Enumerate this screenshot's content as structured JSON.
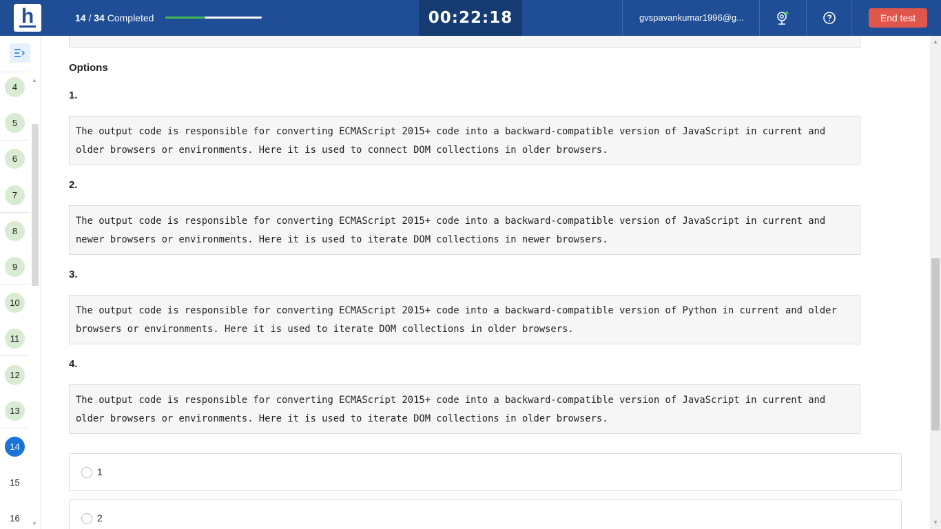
{
  "header": {
    "logo_letter": "h",
    "progress_current": "14",
    "progress_total": "34",
    "progress_suffix": "Completed",
    "progress_fraction": 0.4118,
    "timer": "00:22:18",
    "user": "gvspavankumar1996@g...",
    "end_label": "End test"
  },
  "sidebar": {
    "questions": [
      {
        "n": "4",
        "state": "answered"
      },
      {
        "n": "5",
        "state": "answered"
      },
      {
        "n": "6",
        "state": "answered"
      },
      {
        "n": "7",
        "state": "answered"
      },
      {
        "n": "8",
        "state": "answered"
      },
      {
        "n": "9",
        "state": "answered"
      },
      {
        "n": "10",
        "state": "answered"
      },
      {
        "n": "11",
        "state": "answered"
      },
      {
        "n": "12",
        "state": "answered"
      },
      {
        "n": "13",
        "state": "answered"
      },
      {
        "n": "14",
        "state": "current"
      },
      {
        "n": "15",
        "state": "unanswered"
      },
      {
        "n": "16",
        "state": "unanswered"
      }
    ]
  },
  "question": {
    "options_title": "Options",
    "options": [
      {
        "num": "1.",
        "text": "The output code is responsible for converting ECMAScript 2015+ code into a backward-compatible version of JavaScript in current and older browsers or environments. Here it is used to connect DOM collections in older browsers."
      },
      {
        "num": "2.",
        "text": "The output code is responsible for converting ECMAScript 2015+ code into a backward-compatible version of JavaScript in current and newer browsers or environments. Here it is used to iterate DOM collections in newer browsers."
      },
      {
        "num": "3.",
        "text": "The output code is responsible for converting ECMAScript 2015+ code into a backward-compatible version of Python in current and older browsers or environments. Here it is used to iterate DOM collections in older browsers."
      },
      {
        "num": "4.",
        "text": "The output code is responsible for converting ECMAScript 2015+ code into a backward-compatible version of JavaScript in current and older browsers or environments. Here it is used to iterate DOM collections in older browsers."
      }
    ],
    "choices": [
      "1",
      "2"
    ]
  },
  "colors": {
    "header_bg": "#1f4e96",
    "timer_bg": "#163a72",
    "end_button": "#e0564b",
    "answered": "#d8ecd3",
    "current": "#1a73d8",
    "progress_fill": "#3fb950"
  },
  "icons": {
    "toggle": "sidebar-toggle-icon",
    "camera": "webcam-icon",
    "help": "help-icon"
  }
}
